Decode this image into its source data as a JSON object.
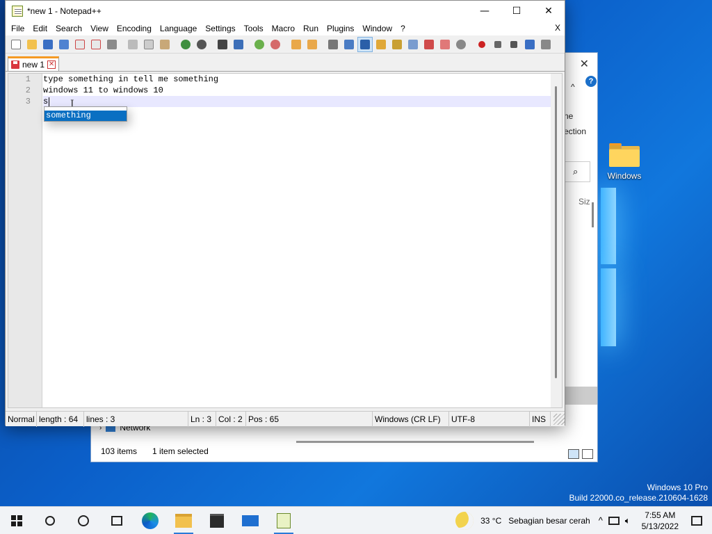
{
  "window": {
    "title": "*new 1 - Notepad++",
    "minimize_glyph": "—",
    "maximize_glyph": "☐",
    "close_glyph": "✕"
  },
  "menu": {
    "items": [
      "File",
      "Edit",
      "Search",
      "View",
      "Encoding",
      "Language",
      "Settings",
      "Tools",
      "Macro",
      "Run",
      "Plugins",
      "Window",
      "?"
    ],
    "close_doc": "X"
  },
  "toolbar": {
    "icons": [
      "new-file-icon",
      "open-file-icon",
      "save-icon",
      "save-all-icon",
      "close-icon",
      "close-all-icon",
      "print-icon",
      "cut-icon",
      "copy-icon",
      "paste-icon",
      "undo-icon",
      "redo-icon",
      "find-icon",
      "replace-icon",
      "zoom-in-icon",
      "zoom-out-icon",
      "sync-v-icon",
      "sync-h-icon",
      "word-wrap-icon",
      "show-all-chars-icon",
      "indent-guide-icon",
      "udl-icon",
      "doc-map-icon",
      "function-list-icon",
      "folder-workspace-icon",
      "monitor-icon",
      "record-macro-icon",
      "stop-record-icon",
      "play-macro-icon",
      "run-macro-multiple-icon",
      "save-macro-icon"
    ]
  },
  "tab": {
    "label": "new 1",
    "close_glyph": "✕"
  },
  "editor": {
    "line_numbers": [
      "1",
      "2",
      "3"
    ],
    "lines": [
      "type something in tell me something",
      "windows 11 to windows 10",
      "s"
    ],
    "autocomplete": {
      "items": [
        "something"
      ],
      "selected": "something"
    }
  },
  "statusbar": {
    "mode": "Normal",
    "length": "length : 64",
    "lines": "lines : 3",
    "ln": "Ln : 3",
    "col": "Col : 2",
    "pos": "Pos : 65",
    "eol": "Windows (CR LF)",
    "encoding": "UTF-8",
    "ins": "INS"
  },
  "explorer": {
    "side_text_1": "ne",
    "side_text_2": "ection",
    "side_text_3": "Siz",
    "help": "?",
    "close_glyph": "✕",
    "network_label": "Network",
    "item_count": "103 items",
    "selection": "1 item selected"
  },
  "desktop": {
    "icon_label": "Windows",
    "edition": "Windows 10 Pro",
    "build": "Build 22000.co_release.210604-1628"
  },
  "taskbar": {
    "weather_temp": "33 °C",
    "weather_desc": "Sebagian besar cerah",
    "chevron": "^",
    "time": "7:55 AM",
    "date": "5/13/2022"
  }
}
